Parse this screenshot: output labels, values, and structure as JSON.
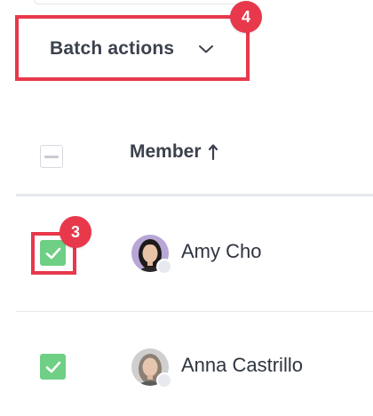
{
  "toolbar": {
    "batch_actions_label": "Batch actions",
    "batch_actions_icon": "chevron-down-icon"
  },
  "annotations": {
    "step_batch": "4",
    "step_checkbox": "3",
    "highlight_color": "#e8384b"
  },
  "table": {
    "columns": [
      {
        "key": "select",
        "label": "",
        "state": "indeterminate"
      },
      {
        "key": "member",
        "label": "Member",
        "sort": "ascending",
        "sort_icon": "sort-up-arrow-icon"
      }
    ],
    "rows": [
      {
        "selected": true,
        "name": "Amy Cho",
        "status": "offline"
      },
      {
        "selected": true,
        "name": "Anna Castrillo",
        "status": "offline"
      }
    ]
  },
  "colors": {
    "checkbox_checked": "#6fcf84",
    "text_primary": "#2f3440",
    "divider": "#e6e8ee"
  }
}
